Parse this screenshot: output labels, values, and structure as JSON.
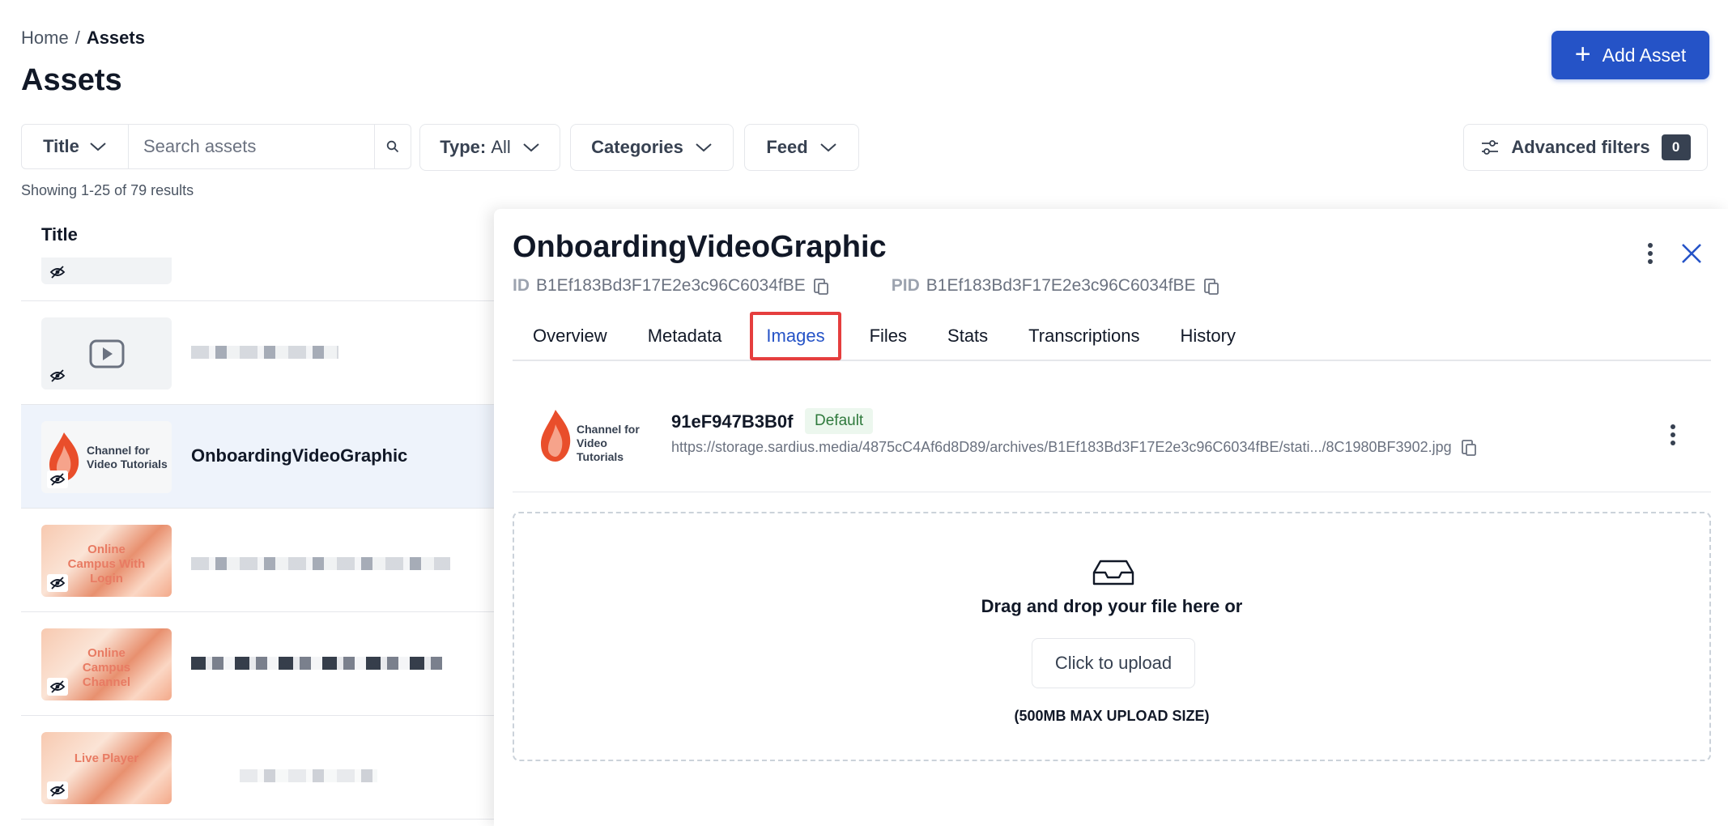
{
  "breadcrumb": {
    "home": "Home",
    "separator": "/",
    "current": "Assets"
  },
  "page_title": "Assets",
  "add_button": {
    "label": "Add Asset"
  },
  "filters": {
    "title_select": "Title",
    "search_placeholder": "Search assets",
    "type_label": "Type:",
    "type_value": "All",
    "categories_label": "Categories",
    "feed_label": "Feed",
    "advanced_label": "Advanced filters",
    "advanced_count": "0"
  },
  "results_text": "Showing 1-25 of 79 results",
  "list": {
    "column_title": "Title",
    "rows": [
      {
        "title": "",
        "thumb_text": ""
      },
      {
        "title": "",
        "thumb_text": ""
      },
      {
        "title": "OnboardingVideoGraphic",
        "thumb_text": "Channel for Video Tutorials"
      },
      {
        "title": "",
        "thumb_text": "Online Campus With Login"
      },
      {
        "title": "",
        "thumb_text": "Online Campus Channel"
      },
      {
        "title": "",
        "thumb_text": "Live Player"
      }
    ]
  },
  "panel": {
    "title": "OnboardingVideoGraphic",
    "id_label": "ID",
    "id_value": "B1Ef183Bd3F17E2e3c96C6034fBE",
    "pid_label": "PID",
    "pid_value": "B1Ef183Bd3F17E2e3c96C6034fBE",
    "tabs": [
      "Overview",
      "Metadata",
      "Images",
      "Files",
      "Stats",
      "Transcriptions",
      "History"
    ],
    "active_tab": "Images",
    "image": {
      "name": "91eF947B3B0f",
      "badge": "Default",
      "url": "https://storage.sardius.media/4875cC4Af6d8D89/archives/B1Ef183Bd3F17E2e3c96C6034fBE/stati.../8C1980BF3902.jpg",
      "thumb_text": "Channel for Video Tutorials"
    },
    "dropzone": {
      "text": "Drag and drop your file here or",
      "button": "Click to upload",
      "max": "(500MB MAX UPLOAD SIZE)"
    }
  },
  "colors": {
    "accent": "#2553c7",
    "highlight": "#e53e3e",
    "badge_bg": "#ecf7ee",
    "badge_fg": "#2f7a3d"
  }
}
